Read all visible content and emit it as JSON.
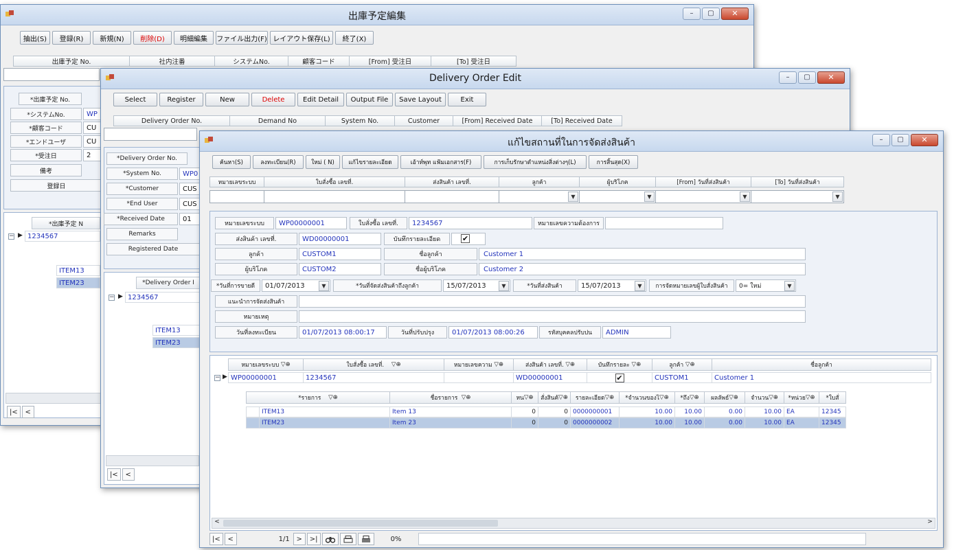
{
  "w1": {
    "title": "出庫予定編集",
    "toolbar": [
      "抽出(S)",
      "登録(R)",
      "新規(N)",
      "削除(D)",
      "明細編集",
      "ファイル出力(F)",
      "レイアウト保存(L)",
      "終了(X)"
    ],
    "headers": [
      "出庫予定 No.",
      "社内注番",
      "システムNo.",
      "顧客コード",
      "[From] 受注日",
      "[To] 受注日"
    ],
    "labels": [
      "*出庫予定 No.",
      "*システムNo.",
      "*顧客コード",
      "*エンドユーザ",
      "*受注日",
      "備考",
      "登録日"
    ],
    "vals": [
      "WP",
      "CU",
      "CU",
      "2"
    ],
    "grid_header": "*出庫予定 N",
    "grid_row": "1234567",
    "items": [
      "ITEM13",
      "ITEM23"
    ]
  },
  "w2": {
    "title": "Delivery Order Edit",
    "toolbar": [
      "Select",
      "Register",
      "New",
      "Delete",
      "Edit Detail",
      "Output File",
      "Save Layout",
      "Exit"
    ],
    "headers": [
      "Delivery Order No.",
      "Demand No",
      "System No.",
      "Customer",
      "[From] Received Date",
      "[To] Received Date"
    ],
    "labels": [
      "*Delivery Order No.",
      "*System No.",
      "*Customer",
      "*End User",
      "*Received Date",
      "Remarks",
      "Registered Date"
    ],
    "vals": [
      "WP0",
      "CUS",
      "CUS",
      "01"
    ],
    "grid_header": "*Delivery Order I",
    "grid_row": "1234567",
    "items": [
      "ITEM13",
      "ITEM23"
    ]
  },
  "w3": {
    "title": "แก้ไขสถานที่ในการจัดส่งสินค้า",
    "toolbar": [
      "ค้นหา(S)",
      "ลงทะเบียน(R)",
      "ใหม่ ( N)",
      "แก้ไขรายละเอียด",
      "เอ้าท์พุท แฟ้มเอกสาร(F)",
      "การเก็บรักษาตำแหน่งสิ่งต่างๆ(L)",
      "การสิ้นสุด(X)"
    ],
    "search_headers": [
      "หมายเลขระบบ",
      "ใบสั่งซื้อ เลขที่.",
      "ส่งสินค้า เลขที่.",
      "ลูกค้า",
      "ผู้บริโภค",
      "[From] วันที่ส่งสินค้า",
      "[To] วันที่ส่งสินค้า"
    ],
    "form": {
      "sysno_label": "หมายเลขระบบ",
      "sysno": "WP00000001",
      "po_label": "ใบสั่งซื้อ เลขที่.",
      "po": "1234567",
      "demand_label": "หมายเลขความต้องการ",
      "do_label": "ส่งสินค้า เลขที่.",
      "do": "WD00000001",
      "detail_label": "บันทึกรายละเอียด",
      "detail_check": "✔",
      "cust_label": "ลูกค้า",
      "cust": "CUSTOM1",
      "cname_label": "ชื่อลูกค้า",
      "cname": "Customer 1",
      "cons_label": "ผู้บริโภค",
      "cons": "CUSTOM2",
      "consname_label": "ชื่อผู้บริโภค",
      "consname": "Customer 2",
      "rdate_label": "*วันที่การขายดี",
      "rdate": "01/07/2013",
      "ddate_label": "*วันที่จัดส่งสินค้าถึงลูกค้า",
      "ddate": "15/07/2013",
      "sdate_label": "*วันที่ส่งสินค้า",
      "sdate": "15/07/2013",
      "numbering_label": "การจัดหมายเลขผู้ใบสั่งสินค้า",
      "numbering": "0= ใหม่",
      "remark1_label": "แนะนำการจัดส่งสินค้า",
      "remark2_label": "หมายเหตุ",
      "reg_label": "วันที่ลงทะเบียน",
      "reg": "01/07/2013 08:00:17",
      "upd_label": "วันที่ปรับปรุง",
      "upd": "01/07/2013 08:00:26",
      "upuser_label": "รหัสบุคคลปรับปน",
      "upuser": "ADMIN"
    },
    "grid_headers": [
      "หมายเลขระบบ",
      "ใบสั่งซื้อ เลขที่.",
      "หมายเลขความ",
      "ส่งสินค้า เลขที่.",
      "บันทึกรายละ",
      "ลูกค้า",
      "ชื่อลูกค้า"
    ],
    "grid_row": [
      "WP00000001",
      "1234567",
      "",
      "WD00000001",
      "✔",
      "CUSTOM1",
      "Customer 1"
    ],
    "sub_headers": [
      "*รายการ",
      "ชื่อรายการ",
      "หน",
      "สั่งสินค้",
      "รายละเอียด",
      "*จำนวนของไ",
      "*ถึง",
      "ผลลัพธ์",
      "จำนวน",
      "*หน่วย",
      "*ใบสั่"
    ],
    "sub_rows": [
      [
        "ITEM13",
        "Item 13",
        "0",
        "0",
        "0000000001",
        "10.00",
        "10.00",
        "0.00",
        "10.00",
        "EA",
        "12345"
      ],
      [
        "ITEM23",
        "Item 23",
        "0",
        "0",
        "0000000002",
        "10.00",
        "10.00",
        "0.00",
        "10.00",
        "EA",
        "12345"
      ]
    ],
    "status": {
      "page": "1/1",
      "progress": "0%"
    }
  }
}
